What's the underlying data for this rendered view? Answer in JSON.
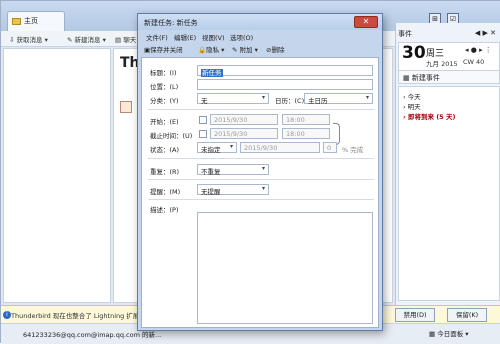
{
  "main_window": {
    "tab_home": "主页",
    "toolbar": {
      "get_mail": "获取消息",
      "new_message": "新建消息",
      "chat": "聊天"
    },
    "content_title": "Thunderbird",
    "tool_icons": [
      "⊞",
      "☑"
    ]
  },
  "today_pane": {
    "title": "事件",
    "day": "30",
    "weekday": "周三",
    "month_year": "九月 2015",
    "cw": "CW 40",
    "new_event": "新建事件",
    "agenda": {
      "today": "今天",
      "tomorrow": "明天",
      "upcoming": "即将到来 (5 天)"
    },
    "today_button": "今日面板"
  },
  "notification": {
    "text": "Thunderbird 现在也整合了 Lightning 扩展",
    "disable_button": "禁用(D)",
    "keep_button": "保留(K)"
  },
  "status_bar": {
    "account": "641233236@qq.com@imap.qq.com 的新..."
  },
  "dialog": {
    "title": "新建任务: 新任务",
    "menus": [
      "文件(F)",
      "编辑(E)",
      "视图(V)",
      "选项(O)"
    ],
    "toolbar": {
      "save_close": "保存并关闭",
      "privacy": "隐私",
      "attach": "附加",
      "delete": "删除"
    },
    "fields": {
      "title_label": "标题：(I)",
      "title_value": "新任务",
      "location_label": "位置：(L)",
      "location_value": "",
      "category_label": "分类：(Y)",
      "category_value": "无",
      "calendar_label": "日历：(C)",
      "calendar_value": "主日历",
      "start_label": "开始：(E)",
      "start_date": "2015/9/30",
      "start_time": "18:00",
      "due_label": "截止时间：(U)",
      "due_date": "2015/9/30",
      "due_time": "18:00",
      "status_label": "状态：(A)",
      "status_value": "未指定",
      "status_date": "2015/9/30",
      "percent_value": "0",
      "percent_label": "% 完成",
      "repeat_label": "重复：(R)",
      "repeat_value": "不重复",
      "reminder_label": "提醒：(M)",
      "reminder_value": "无提醒",
      "description_label": "描述：(P)"
    }
  }
}
